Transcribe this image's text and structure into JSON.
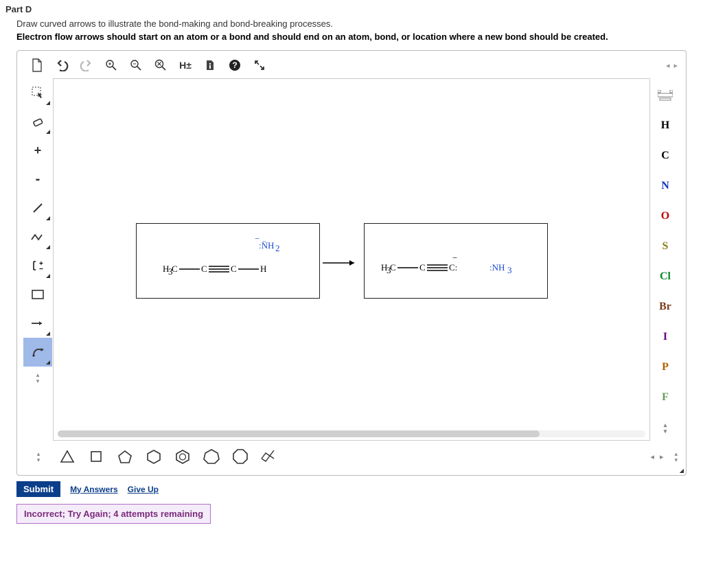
{
  "part_label": "Part D",
  "instruction1": "Draw curved arrows to illustrate the bond-making and bond-breaking processes.",
  "instruction2": "Electron flow arrows should start on an atom or a bond and should end on an atom, bond, or location where a new bond should be created.",
  "top_toolbar": {
    "new": "new-doc",
    "undo": "undo",
    "redo": "redo",
    "zoom_in": "zoom-in",
    "zoom_out": "zoom-out",
    "zoom_reset": "clear-zoom",
    "h_toggle_label": "H±",
    "info": "info",
    "help": "?",
    "fullscreen": "fullscreen"
  },
  "left_tools": [
    "select",
    "eraser",
    "plus",
    "minus",
    "single-bond",
    "curved-arrow",
    "bracket-charge",
    "rectangle",
    "straight-arrow",
    "mechanism-arrow"
  ],
  "right_elements": [
    "H",
    "C",
    "N",
    "O",
    "S",
    "Cl",
    "Br",
    "I",
    "P",
    "F"
  ],
  "bottom_shapes": [
    "spinner",
    "triangle",
    "square",
    "pentagon",
    "hexagon",
    "hexagon2",
    "heptagon",
    "octagon",
    "chair"
  ],
  "reaction": {
    "reactant": {
      "chain": "H3C—C≡C—H",
      "above": ":N̈H2",
      "above_charge": "−"
    },
    "product": {
      "chain": "H3C—C≡C:",
      "right": ":NH3",
      "charge": "−"
    }
  },
  "actions": {
    "submit": "Submit",
    "my_answers": "My Answers",
    "give_up": "Give Up"
  },
  "feedback": "Incorrect; Try Again; 4 attempts remaining"
}
